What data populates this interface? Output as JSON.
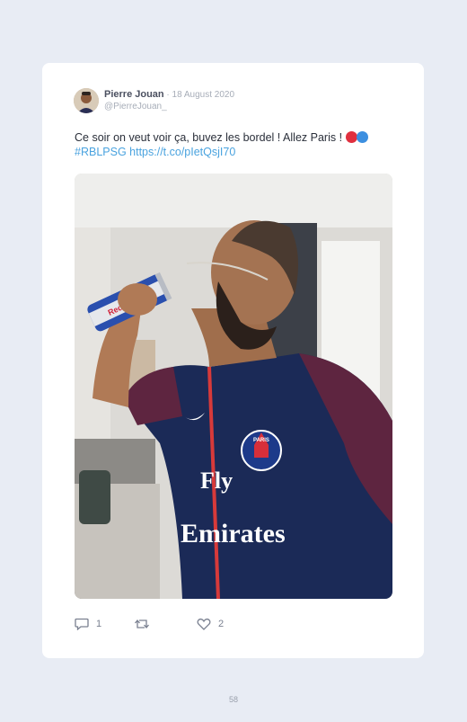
{
  "tweet": {
    "author_name": "Pierre Jouan",
    "date": " · 18 August 2020",
    "handle": "@PierreJouan_",
    "text": "Ce soir on veut voir ça, buvez les bordel ! Allez Paris !",
    "hashtag": "#RBLPSG",
    "url": "https://t.co/pIetQsjI70",
    "emoji_names": [
      "red-circle",
      "blue-circle"
    ],
    "colors": {
      "link": "#4aa3df",
      "red": "#e0303f",
      "blue": "#3c8fe0"
    }
  },
  "photo": {
    "can_text": "Red Bull",
    "jersey_text_top": "Fly",
    "jersey_text_bottom": "Emirates",
    "badge_text": "PARIS"
  },
  "actions": {
    "reply_count": "1",
    "like_count": "2",
    "icons": [
      "reply-icon",
      "retweet-icon",
      "like-icon"
    ]
  },
  "page": {
    "number": "58"
  }
}
